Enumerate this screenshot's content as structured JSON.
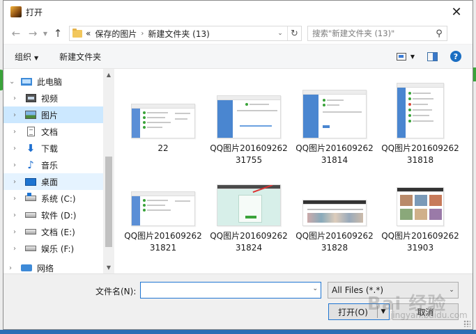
{
  "window": {
    "title": "打开",
    "close": "✕"
  },
  "nav": {
    "breadcrumb": [
      "«",
      "保存的图片",
      "新建文件夹 (13)"
    ],
    "search_placeholder": "搜索\"新建文件夹 (13)\""
  },
  "toolbar": {
    "organize": "组织",
    "new_folder": "新建文件夹"
  },
  "sidebar": {
    "items": [
      {
        "label": "此电脑",
        "icon": "pc-icon"
      },
      {
        "label": "视频",
        "icon": "video-icon"
      },
      {
        "label": "图片",
        "icon": "picture-icon",
        "selected": true
      },
      {
        "label": "文档",
        "icon": "document-icon"
      },
      {
        "label": "下载",
        "icon": "download-icon"
      },
      {
        "label": "音乐",
        "icon": "music-icon"
      },
      {
        "label": "桌面",
        "icon": "desktop-icon"
      },
      {
        "label": "系统 (C:)",
        "icon": "drive-icon"
      },
      {
        "label": "软件 (D:)",
        "icon": "drive-icon"
      },
      {
        "label": "文档 (E:)",
        "icon": "drive-icon"
      },
      {
        "label": "娱乐 (F:)",
        "icon": "drive-icon"
      },
      {
        "label": "网络",
        "icon": "network-icon"
      }
    ]
  },
  "files": [
    {
      "name": "22"
    },
    {
      "name": "QQ图片20160926231755"
    },
    {
      "name": "QQ图片20160926231814"
    },
    {
      "name": "QQ图片20160926231818"
    },
    {
      "name": "QQ图片20160926231821"
    },
    {
      "name": "QQ图片20160926231824"
    },
    {
      "name": "QQ图片20160926231828"
    },
    {
      "name": "QQ图片20160926231903"
    }
  ],
  "footer": {
    "filename_label": "文件名(N):",
    "filename_value": "",
    "filter": "All Files (*.*)",
    "open": "打开(O)",
    "cancel": "取消"
  },
  "watermark": {
    "text": "Bai 经验",
    "sub": "jingyan.baidu.com"
  }
}
